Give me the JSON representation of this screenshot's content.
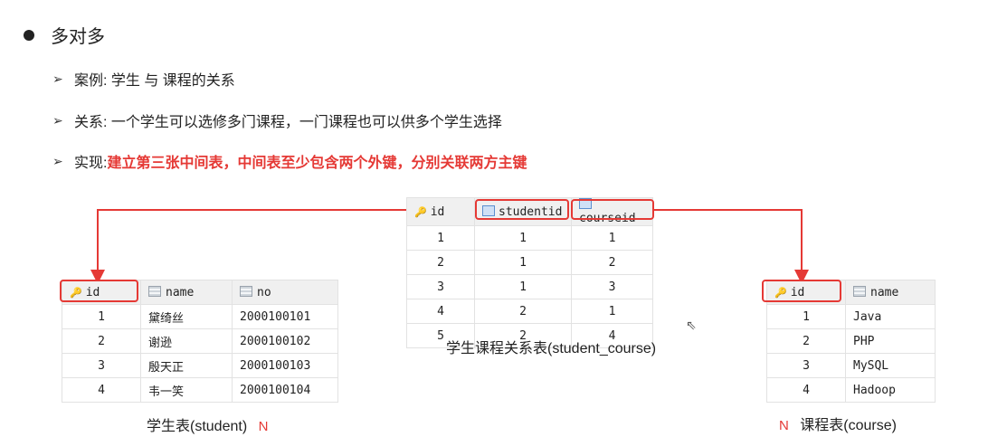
{
  "title": "多对多",
  "bullets": [
    {
      "label": "案例: 学生 与 课程的关系",
      "highlight": ""
    },
    {
      "label": "关系: 一个学生可以选修多门课程，一门课程也可以供多个学生选择",
      "highlight": ""
    },
    {
      "label": "实现: ",
      "highlight": "建立第三张中间表，中间表至少包含两个外键，分别关联两方主键"
    }
  ],
  "student_table": {
    "columns": [
      "id",
      "name",
      "no"
    ],
    "rows": [
      [
        "1",
        "黛绮丝",
        "2000100101"
      ],
      [
        "2",
        "谢逊",
        "2000100102"
      ],
      [
        "3",
        "殷天正",
        "2000100103"
      ],
      [
        "4",
        "韦一笑",
        "2000100104"
      ]
    ],
    "caption": "学生表(student)",
    "cardinality": "N"
  },
  "link_table": {
    "columns": [
      "id",
      "studentid",
      "courseid"
    ],
    "rows": [
      [
        "1",
        "1",
        "1"
      ],
      [
        "2",
        "1",
        "2"
      ],
      [
        "3",
        "1",
        "3"
      ],
      [
        "4",
        "2",
        "1"
      ],
      [
        "5",
        "2",
        "4"
      ]
    ],
    "caption": "学生课程关系表(student_course)"
  },
  "course_table": {
    "columns": [
      "id",
      "name"
    ],
    "rows": [
      [
        "1",
        "Java"
      ],
      [
        "2",
        "PHP"
      ],
      [
        "3",
        "MySQL"
      ],
      [
        "4",
        "Hadoop"
      ]
    ],
    "caption": "课程表(course)",
    "cardinality": "N"
  },
  "colors": {
    "accent": "#e53935",
    "header_bg": "#f0f0f0"
  }
}
